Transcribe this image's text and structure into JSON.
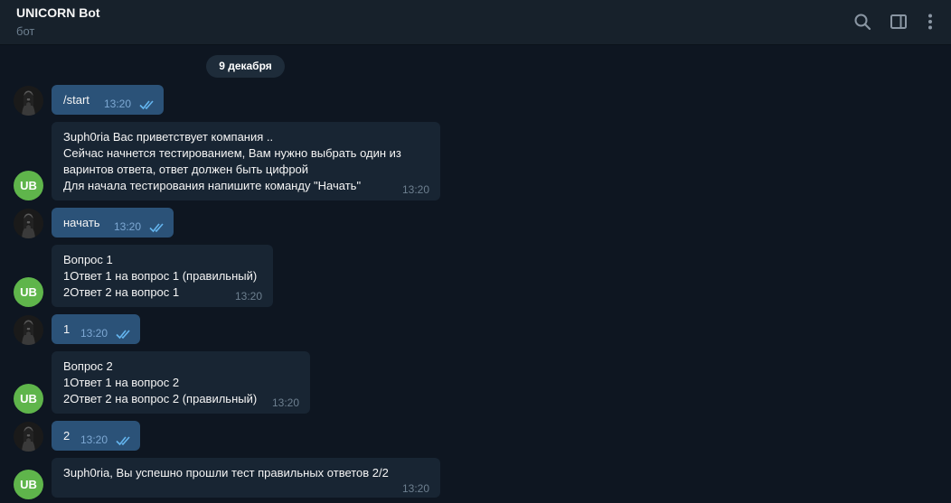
{
  "header": {
    "title": "UNICORN Bot",
    "subtitle": "бот",
    "icons": [
      "search-icon",
      "sidebar-toggle-icon",
      "more-vertical-icon"
    ]
  },
  "date_separator": "9 декабря",
  "bot_avatar_initials": "UB",
  "colors": {
    "background": "#0e1621",
    "header": "#17212b",
    "outgoing_bubble": "#2b5278",
    "incoming_bubble": "#182533",
    "bot_avatar": "#5fb54b",
    "read_ticks": "#64b5ef"
  },
  "messages": [
    {
      "dir": "out",
      "text": "/start",
      "time": "13:20",
      "read": true
    },
    {
      "dir": "in",
      "text": "Зuph0ria Вас приветствует компания ..\nСейчас начнется тестированием, Вам нужно выбрать один из\nварин­тов ответа, ответ должен быть цифрой\nДля начала тестирования напишите команду \"Начать\"",
      "time": "13:20"
    },
    {
      "dir": "out",
      "text": "начать",
      "time": "13:20",
      "read": true
    },
    {
      "dir": "in",
      "text": "Вопрос 1\n1Ответ 1 на вопрос 1 (правильный)\n2Ответ 2 на вопрос 1",
      "time": "13:20"
    },
    {
      "dir": "out",
      "text": "1",
      "time": "13:20",
      "read": true
    },
    {
      "dir": "in",
      "text": "Вопрос 2\n1Ответ 1 на вопрос 2\n2Ответ 2 на вопрос 2 (правильный)",
      "time": "13:20"
    },
    {
      "dir": "out",
      "text": "2",
      "time": "13:20",
      "read": true
    },
    {
      "dir": "in",
      "text": "Зuph0ria, Вы успешно прошли тест правильных ответов 2/2",
      "time": "13:20"
    }
  ]
}
